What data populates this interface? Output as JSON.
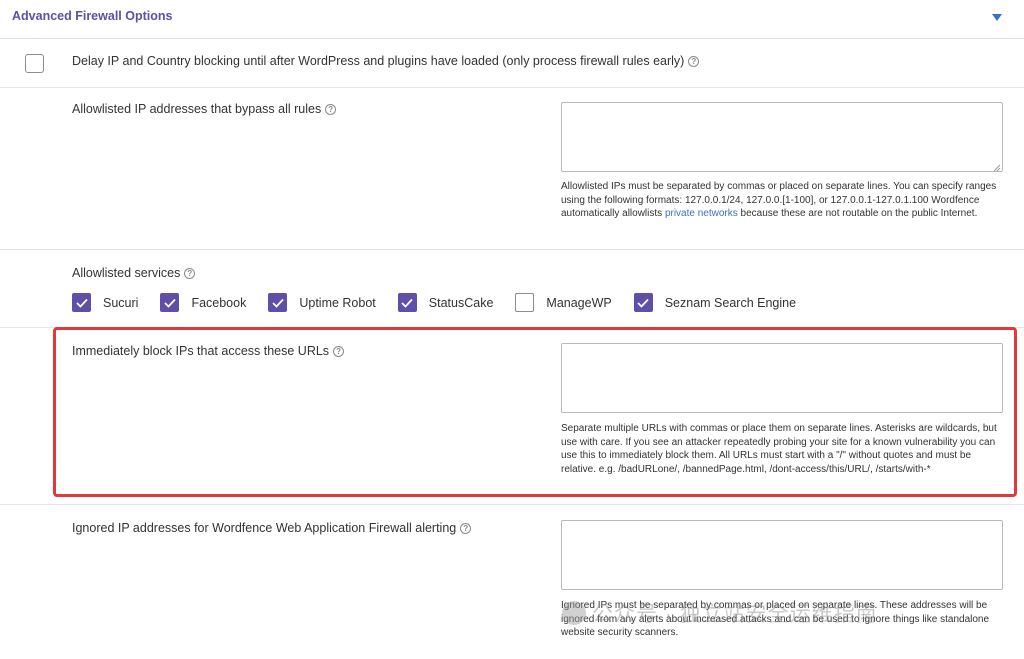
{
  "header": {
    "title": "Advanced Firewall Options"
  },
  "delay_option": {
    "label": "Delay IP and Country blocking until after WordPress and plugins have loaded (only process firewall rules early)",
    "checked": false
  },
  "allowlisted_ips": {
    "label": "Allowlisted IP addresses that bypass all rules",
    "value": "",
    "help_before": "Allowlisted IPs must be separated by commas or placed on separate lines. You can specify ranges using the following formats: 127.0.0.1/24, 127.0.0.[1-100], or 127.0.0.1-127.0.1.100 Wordfence automatically allowlists",
    "help_link": "private networks",
    "help_after": "because these are not routable on the public Internet."
  },
  "allowlisted_services": {
    "label": "Allowlisted services",
    "items": [
      {
        "label": "Sucuri",
        "checked": true
      },
      {
        "label": "Facebook",
        "checked": true
      },
      {
        "label": "Uptime Robot",
        "checked": true
      },
      {
        "label": "StatusCake",
        "checked": true
      },
      {
        "label": "ManageWP",
        "checked": false
      },
      {
        "label": "Seznam Search Engine",
        "checked": true
      }
    ]
  },
  "block_urls": {
    "label": "Immediately block IPs that access these URLs",
    "value": "",
    "help": "Separate multiple URLs with commas or place them on separate lines. Asterisks are wildcards, but use with care. If you see an attacker repeatedly probing your site for a known vulnerability you can use this to immediately block them. All URLs must start with a \"/\" without quotes and must be relative. e.g. /badURLone/, /bannedPage.html, /dont-access/this/URL/, /starts/with-*"
  },
  "ignored_ips": {
    "label": "Ignored IP addresses for Wordfence Web Application Firewall alerting",
    "value": "",
    "help": "Ignored IPs must be separated by commas or placed on separate lines. These addresses will be ignored from any alerts about increased attacks and can be used to ignore things like standalone website security scanners."
  },
  "watermark": {
    "text": "公众号 · 独立站安全运维指南"
  },
  "colors": {
    "accent": "#5f4fa8",
    "highlight": "#e0383b",
    "link": "#3d6fc4"
  }
}
